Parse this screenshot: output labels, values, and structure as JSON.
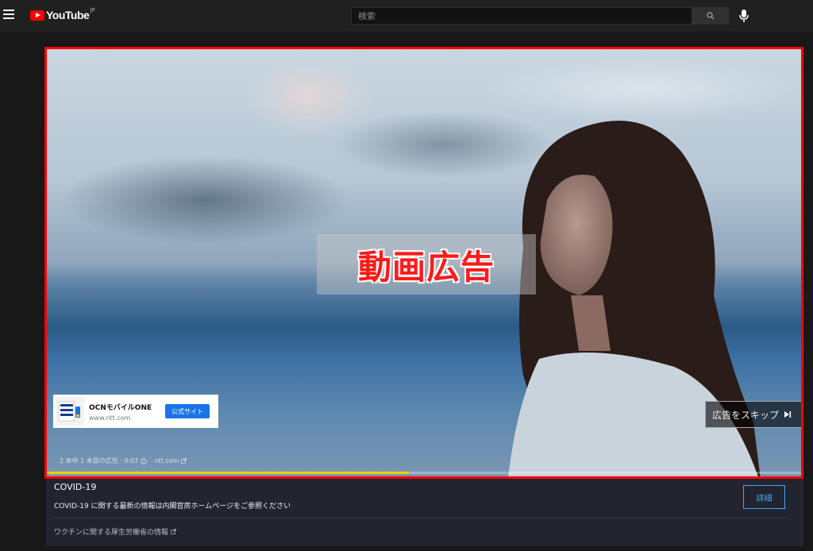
{
  "header": {
    "logo_text": "YouTube",
    "logo_region": "JP",
    "search_placeholder": "検索",
    "icons": [
      "menu-icon",
      "search-icon",
      "microphone-icon"
    ]
  },
  "player": {
    "overlay_title": "動画広告",
    "ad_card": {
      "advertiser": "OCNモバイルONE",
      "url": "www.ntt.com",
      "button_label": "公式サイト"
    },
    "skip_label": "広告をスキップ",
    "ad_status": "2 本中 1 本目の広告 · 0:07",
    "ad_domain": "ntt.com",
    "progress_fraction": 0.48,
    "colors": {
      "progress": "#ffcc00",
      "accent": "#ff0000"
    }
  },
  "info_panel": {
    "title": "COVID-19",
    "text": "COVID-19 に関する最新の情報は内閣官房ホームページをご参照ください",
    "details_label": "詳細",
    "link_text": "ワクチンに関する厚生労働省の情報"
  }
}
